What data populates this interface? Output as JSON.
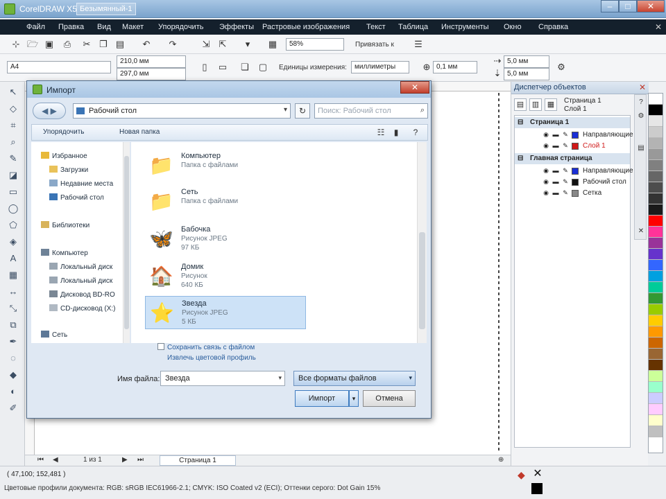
{
  "window": {
    "app_title": "CorelDRAW X5",
    "doc_title": "Безымянный-1",
    "controls": {
      "minimize": "–",
      "maximize": "□",
      "close": "✕"
    }
  },
  "menu": {
    "items": [
      "Файл",
      "Правка",
      "Вид",
      "Макет",
      "Упорядочить",
      "Эффекты",
      "Растровые изображения",
      "Текст",
      "Таблица",
      "Инструменты",
      "Окно",
      "Справка"
    ]
  },
  "toolbar": {
    "zoom_value": "58%",
    "snap_label": "Привязать к",
    "page_preset": "A4",
    "width_value": "210,0 мм",
    "height_value": "297,0 мм",
    "units_label": "Единицы измерения:",
    "units_value": "миллиметры",
    "nudge_value": "0,1 мм",
    "dup_x": "5,0 мм",
    "dup_y": "5,0 мм"
  },
  "docker": {
    "title": "Диспетчер объектов",
    "current_page": "Страница 1",
    "current_layer": "Слой 1",
    "tree": [
      {
        "kind": "head",
        "label": "Страница 1"
      },
      {
        "kind": "layer",
        "label": "Направляющие",
        "color": "#1a2fd6"
      },
      {
        "kind": "layer",
        "label": "Слой 1",
        "color": "#d01818"
      },
      {
        "kind": "head",
        "label": "Главная страница"
      },
      {
        "kind": "layer",
        "label": "Направляющие",
        "color": "#1a2fd6"
      },
      {
        "kind": "layer",
        "label": "Рабочий стол",
        "color": "#111111"
      },
      {
        "kind": "layer",
        "label": "Сетка",
        "color": "#888888"
      }
    ]
  },
  "page_nav": {
    "counter": "1 из 1",
    "page_tab": "Страница 1"
  },
  "status": {
    "coords": "( 47,100; 152,481 )",
    "color_profile": "Цветовые профили документа: RGB: sRGB IEC61966-2.1; CMYK: ISO Coated v2 (ECI); Оттенки серого: Dot Gain 15%"
  },
  "palette": [
    "#ffffff",
    "#000000",
    "#e6e6e6",
    "#cccccc",
    "#b3b3b3",
    "#999999",
    "#808080",
    "#666666",
    "#4d4d4d",
    "#333333",
    "#1a1a1a",
    "#ff0000",
    "#ff3399",
    "#993399",
    "#6633cc",
    "#3366ff",
    "#00a0e0",
    "#00cc99",
    "#339933",
    "#99cc00",
    "#ffcc00",
    "#ff9900",
    "#cc6600",
    "#996633",
    "#663300",
    "#ccff99",
    "#99ffcc",
    "#ccccff",
    "#ffccff",
    "#ffffcc",
    "#c0c0c0"
  ],
  "dialog": {
    "title": "Импорт",
    "address": "Рабочий стол",
    "search_placeholder": "Поиск: Рабочий стол",
    "organize": "Упорядочить",
    "new_folder": "Новая папка",
    "nav": {
      "favorites": "Избранное",
      "downloads": "Загрузки",
      "recent": "Недавние места",
      "desktop": "Рабочий стол",
      "libraries": "Библиотеки",
      "computer": "Компьютер",
      "local1": "Локальный диск",
      "local2": "Локальный диск",
      "dvd": "Дисковод BD-RO",
      "cd": "CD-дисковод (X:)",
      "network": "Сеть"
    },
    "files": [
      {
        "name": "Компьютер",
        "type": "Папка с файлами",
        "size": "",
        "icon": "📁"
      },
      {
        "name": "Сеть",
        "type": "Папка с файлами",
        "size": "",
        "icon": "📁"
      },
      {
        "name": "Бабочка",
        "type": "Рисунок JPEG",
        "size": "97 КБ",
        "icon": "🦋"
      },
      {
        "name": "Домик",
        "type": "Рисунок",
        "size": "640 КБ",
        "icon": "🏠"
      },
      {
        "name": "Звезда",
        "type": "Рисунок JPEG",
        "size": "5 КБ",
        "icon": "⭐"
      }
    ],
    "opt_maintain": "Сохранить связь с файлом",
    "opt_extract": "Извлечь цветовой профиль",
    "file_name_label": "Имя файла:",
    "file_name_value": "Звезда",
    "file_type": "Все форматы файлов",
    "import_button": "Импорт",
    "cancel_button": "Отмена"
  }
}
